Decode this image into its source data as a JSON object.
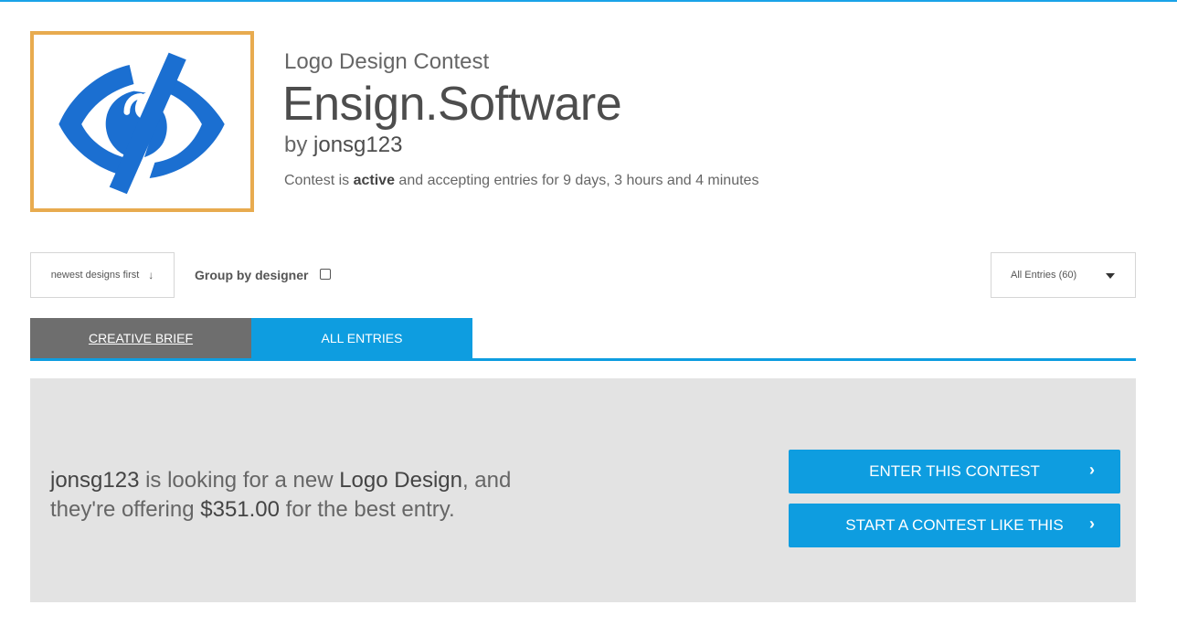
{
  "header": {
    "subtitle": "Logo Design Contest",
    "title": "Ensign.Software",
    "by_prefix": "by",
    "by_name": "jonsg123",
    "status_prefix": "Contest is",
    "status_word": "active",
    "status_suffix": "and accepting entries for 9 days, 3 hours and 4 minutes"
  },
  "logo": {
    "icon": "eye-slash-icon",
    "primary_color": "#1b6fd1",
    "frame_color": "#e8ab4f"
  },
  "controls": {
    "sort_label": "newest designs first",
    "sort_icon": "↓",
    "group_label": "Group by designer",
    "filter_label": "All Entries (60)"
  },
  "tabs": [
    {
      "label": "CREATIVE BRIEF"
    },
    {
      "label": "ALL ENTRIES"
    }
  ],
  "panel": {
    "name": "jonsg123",
    "text1": " is looking for a new ",
    "category": "Logo Design",
    "text2": ", and they're offering ",
    "prize": "$351.00",
    "text3": " for the best entry.",
    "enter_label": "ENTER THIS CONTEST",
    "start_label": "START A CONTEST LIKE THIS",
    "chevron": "›"
  },
  "colors": {
    "accent": "#0e9de0",
    "tab_inactive": "#6e6e6e",
    "panel_bg": "#e3e3e3"
  }
}
